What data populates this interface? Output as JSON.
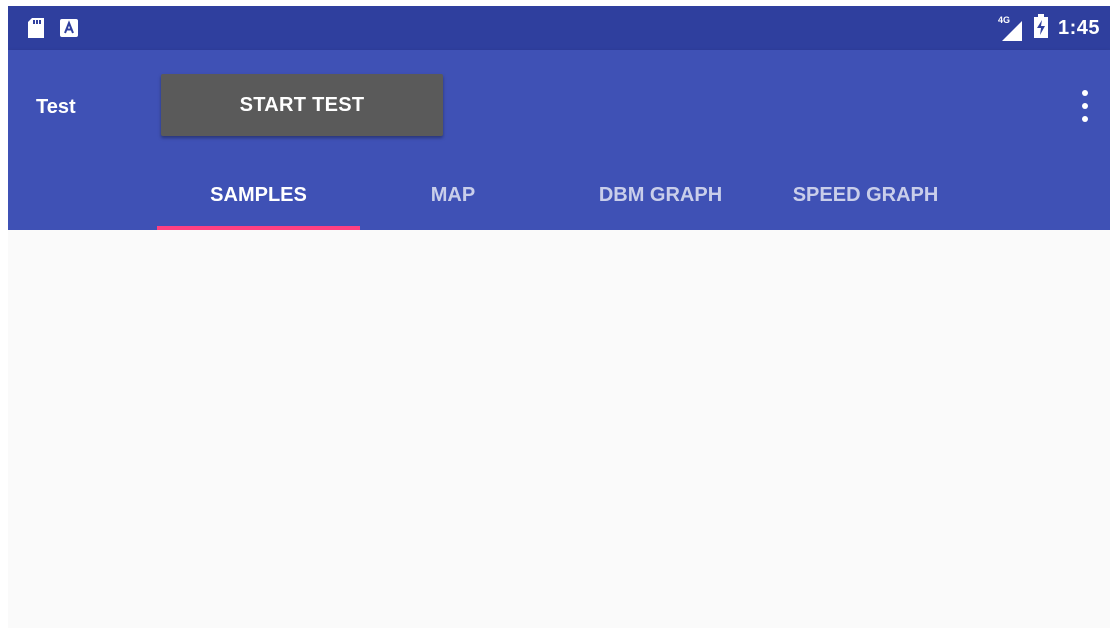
{
  "status_bar": {
    "left_icons": [
      "sd-card-icon",
      "a-notification-icon"
    ],
    "network": "4G",
    "time": "1:45"
  },
  "toolbar": {
    "title": "Test",
    "start_button_label": "START TEST",
    "overflow_icon": "more-vert-icon"
  },
  "tabs": [
    {
      "label": "SAMPLES",
      "active": true
    },
    {
      "label": "MAP",
      "active": false
    },
    {
      "label": "DBM GRAPH",
      "active": false
    },
    {
      "label": "SPEED GRAPH",
      "active": false
    }
  ],
  "colors": {
    "status_bar": "#2f3f9e",
    "primary": "#3f51b5",
    "accent": "#ff4081",
    "button": "#5a5a5a",
    "background": "#fafafa"
  }
}
